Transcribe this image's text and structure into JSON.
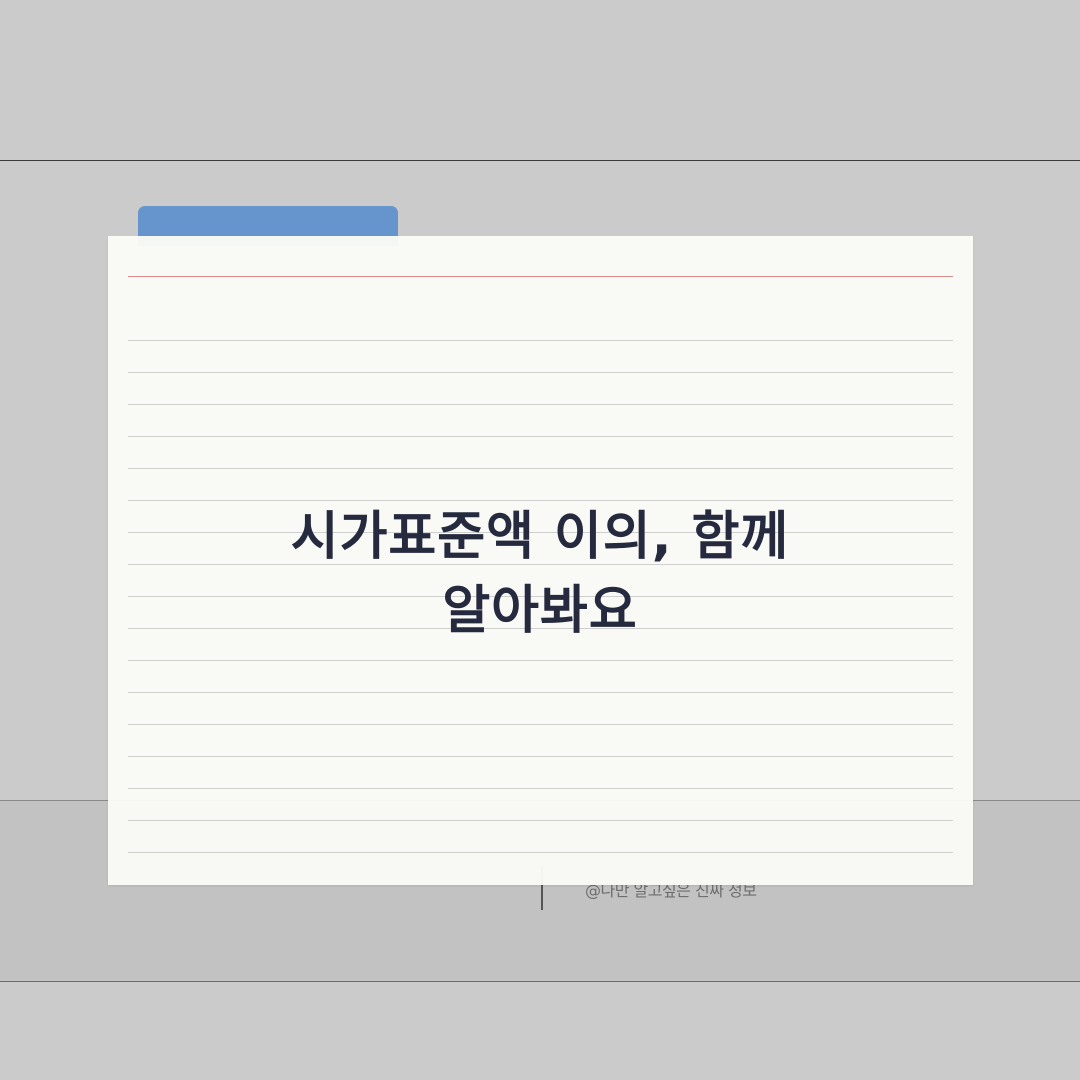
{
  "card": {
    "title_line1": "시가표준액 이의, 함께",
    "title_line2": "알아봐요"
  },
  "watermark": {
    "text": "@나만 알고싶은 진짜 정보"
  },
  "colors": {
    "background": "#cbcbcb",
    "tab": "#6595cc",
    "card": "#fafaf6",
    "margin_line": "#d98a8a",
    "title": "#262a3e"
  }
}
